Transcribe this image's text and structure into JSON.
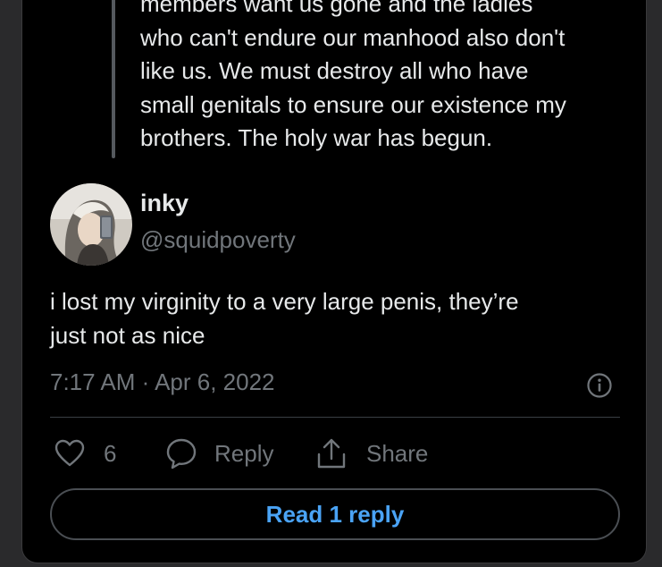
{
  "quoted_tweet": {
    "lines": [
      "members want us gone and the ladies",
      "who can't endure our manhood also don't",
      "like us. We must destroy all who have",
      "small genitals to ensure our existence my",
      "brothers. The holy war has begun."
    ]
  },
  "tweet": {
    "author_name": "inky",
    "author_handle": "@squidpoverty",
    "text_line1": "i lost my virginity to a very large penis, they’re",
    "text_line2": "just not as nice",
    "timestamp": "7:17 AM · Apr 6, 2022"
  },
  "actions": {
    "like_count": "6",
    "reply_label": "Reply",
    "share_label": "Share"
  },
  "read_reply_label": "Read 1 reply",
  "colors": {
    "background": "#000000",
    "text": "#e7e9ea",
    "muted": "#71767b",
    "accent": "#4aa3f5"
  },
  "icons": [
    "heart-icon",
    "reply-bubble-icon",
    "share-icon",
    "info-icon"
  ]
}
